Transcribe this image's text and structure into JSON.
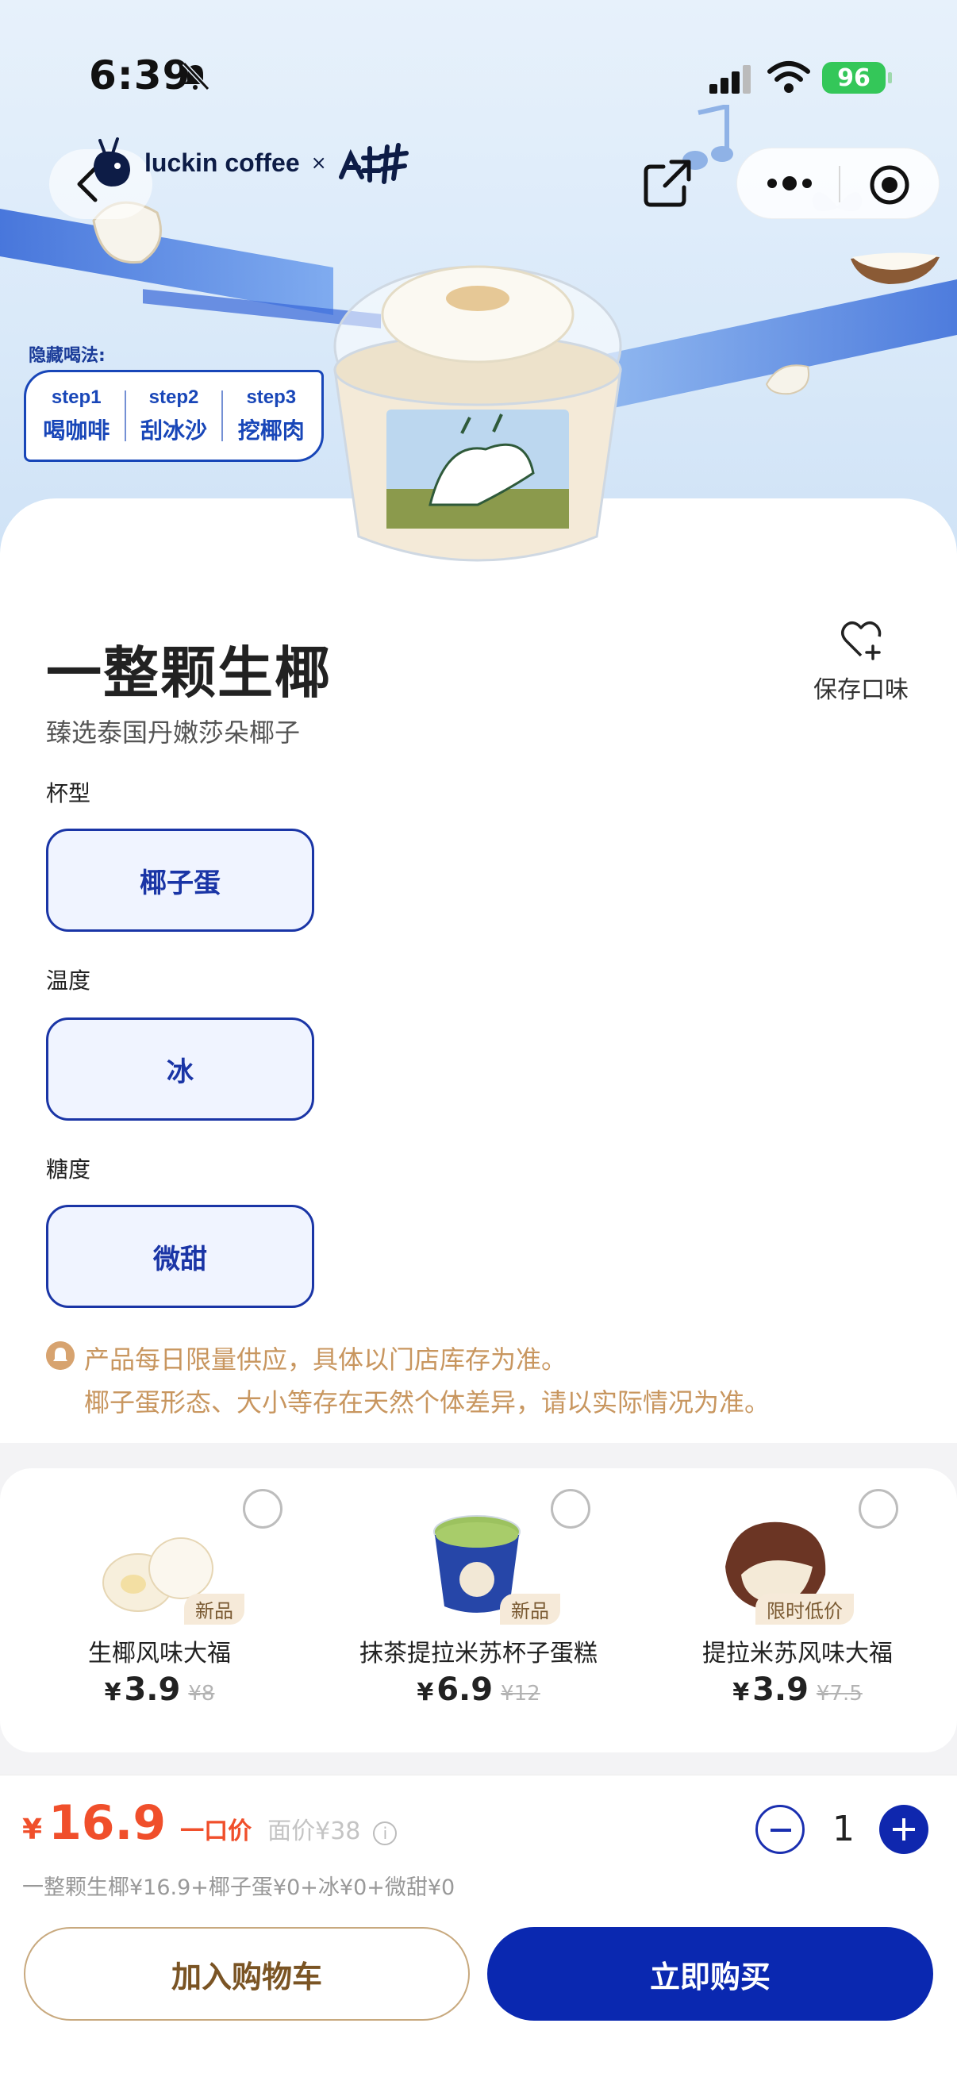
{
  "status_bar": {
    "time": "6:39",
    "battery": "96"
  },
  "brand": {
    "name": "luckin coffee",
    "cross": "×"
  },
  "hero": {
    "hidden_tip_title": "隐藏喝法:",
    "steps": [
      {
        "label": "step1",
        "action": "喝咖啡"
      },
      {
        "label": "step2",
        "action": "刮冰沙"
      },
      {
        "label": "step3",
        "action": "挖椰肉"
      }
    ]
  },
  "product": {
    "title": "一整颗生椰",
    "subtitle": "臻选泰国丹嫩莎朵椰子",
    "save_label": "保存口味"
  },
  "options": [
    {
      "label": "杯型",
      "value": "椰子蛋"
    },
    {
      "label": "温度",
      "value": "冰"
    },
    {
      "label": "糖度",
      "value": "微甜"
    }
  ],
  "notice": [
    "产品每日限量供应，具体以门店库存为准。",
    "椰子蛋形态、大小等存在天然个体差异，请以实际情况为准。"
  ],
  "recommendations": [
    {
      "name": "生椰风味大福",
      "tag": "新品",
      "currency": "¥",
      "price": "3.9",
      "original": "¥8"
    },
    {
      "name": "抹茶提拉米苏杯子蛋糕",
      "tag": "新品",
      "currency": "¥",
      "price": "6.9",
      "original": "¥12"
    },
    {
      "name": "提拉米苏风味大福",
      "tag": "限时低价",
      "currency": "¥",
      "price": "3.9",
      "original": "¥7.5"
    }
  ],
  "footer": {
    "currency": "¥",
    "price": "16.9",
    "price_tag": "一口价",
    "face_value": "面价¥38",
    "info": "i",
    "quantity": "1",
    "summary": "一整颗生椰¥16.9+椰子蛋¥0+冰¥0+微甜¥0",
    "add_to_cart": "加入购物车",
    "buy_now": "立即购买"
  },
  "colors": {
    "primary": "#0a28b0",
    "price": "#f04f2b",
    "notice": "#c8965f"
  }
}
